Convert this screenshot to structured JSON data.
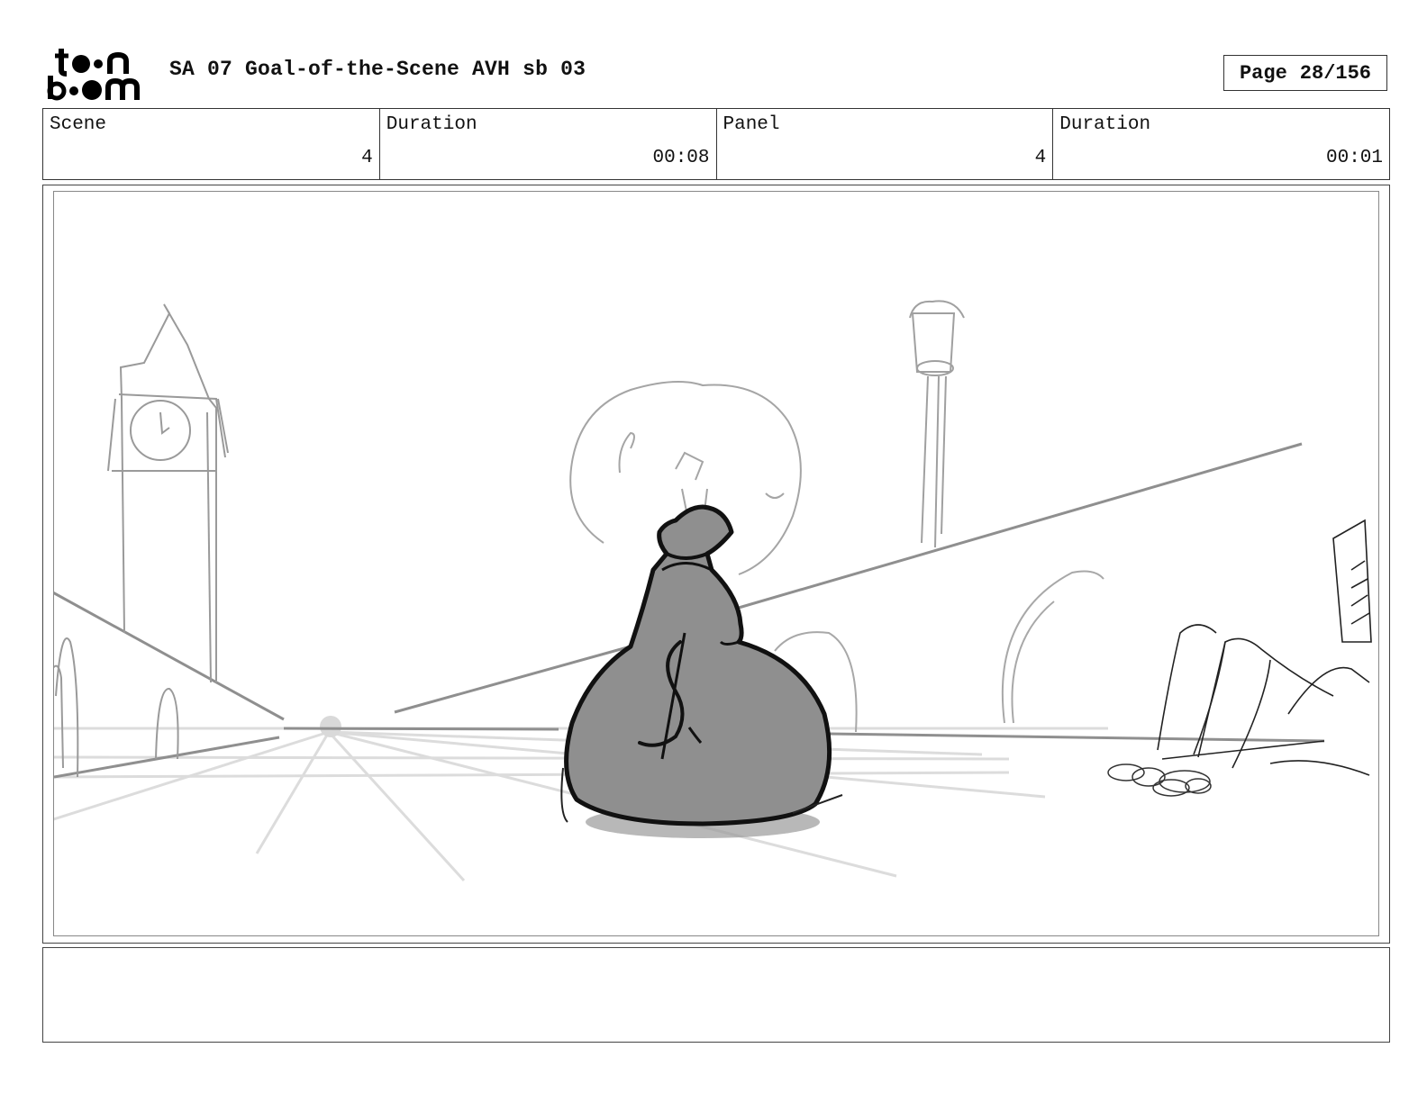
{
  "header": {
    "logo_text_line1": "toon",
    "logo_text_line2": "boom",
    "title": "SA 07 Goal-of-the-Scene AVH sb 03",
    "page_label": "Page",
    "page_value": "28/156"
  },
  "info": {
    "scene_label": "Scene",
    "scene_value": "4",
    "scene_duration_label": "Duration",
    "scene_duration_value": "00:08",
    "panel_label": "Panel",
    "panel_value": "4",
    "panel_duration_label": "Duration",
    "panel_duration_value": "00:01"
  },
  "panel_image": {
    "depicts": [
      "money-bag",
      "clock-tower",
      "street-lamp",
      "bridge",
      "coins",
      "character-legs"
    ],
    "colors": {
      "bag_fill": "#8f8f8f",
      "ink": "#111111",
      "sketch": "#9a9a9a",
      "light_sketch": "#d6d6d6"
    }
  },
  "notes": {
    "text": ""
  }
}
